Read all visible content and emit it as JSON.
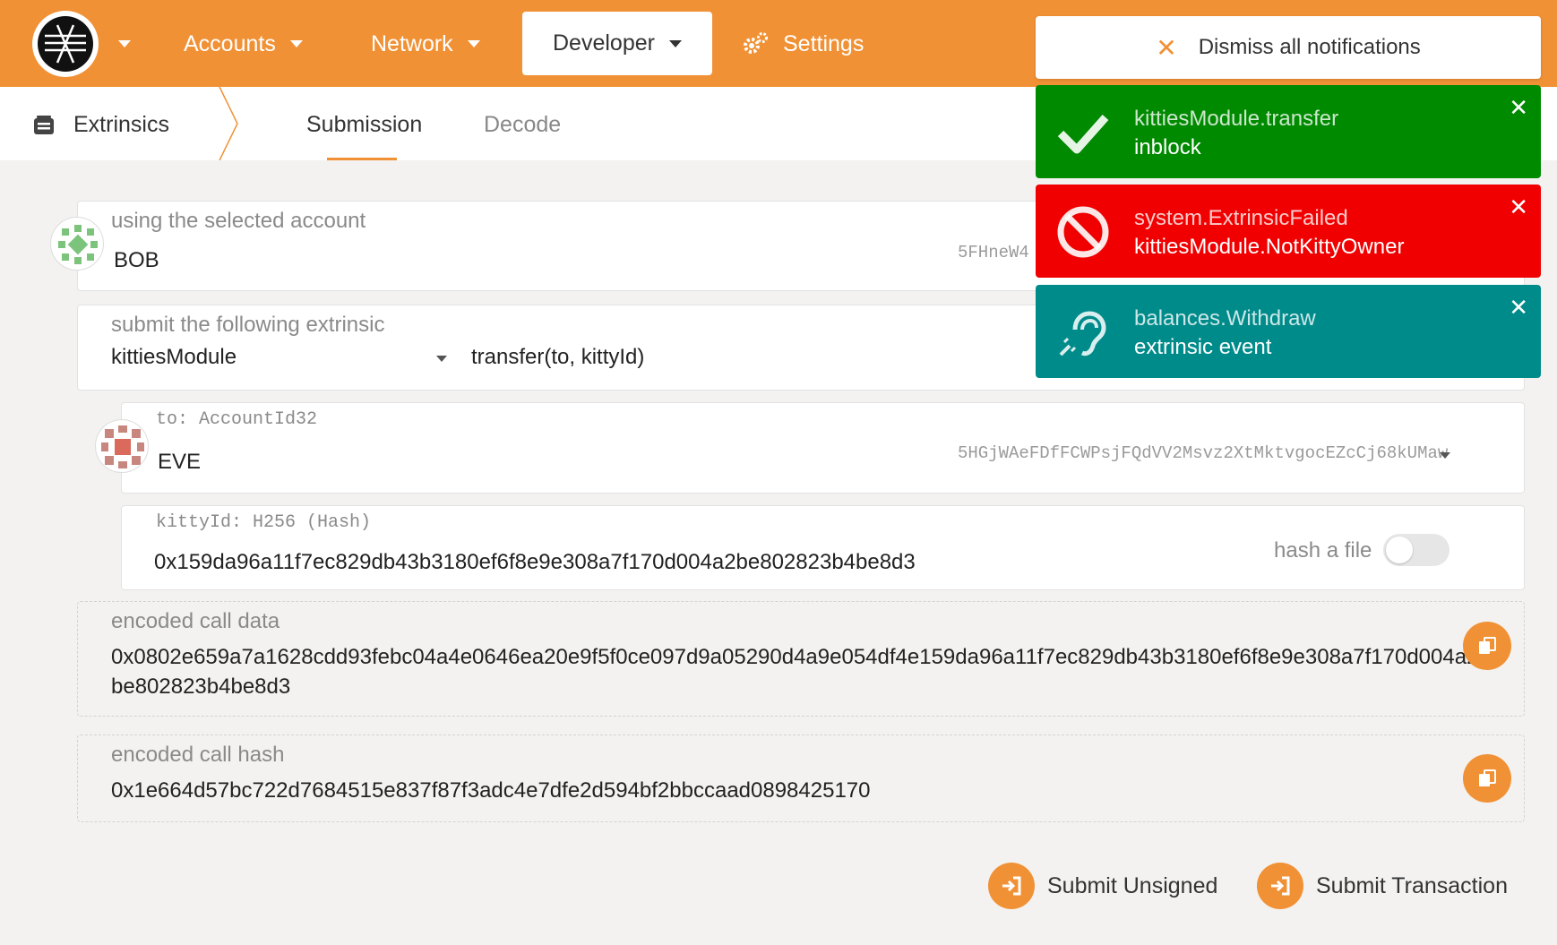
{
  "nav": {
    "items": [
      {
        "label": "Accounts"
      },
      {
        "label": "Network"
      },
      {
        "label": "Developer"
      },
      {
        "label": "Settings"
      }
    ]
  },
  "subnav": {
    "title": "Extrinsics",
    "tabs": [
      {
        "label": "Submission"
      },
      {
        "label": "Decode"
      }
    ]
  },
  "account": {
    "label": "using the selected account",
    "name": "BOB",
    "address": "5FHneW4"
  },
  "extrinsic": {
    "label": "submit the following extrinsic",
    "module": "kittiesModule",
    "method": "transfer(to, kittyId)"
  },
  "param_to": {
    "label": "to: AccountId32",
    "name": "EVE",
    "address": "5HGjWAeFDfFCWPsjFQdVV2Msvz2XtMktvgocEZcCj68kUMaw"
  },
  "param_kitty": {
    "label": "kittyId: H256 (Hash)",
    "value": "0x159da96a11f7ec829db43b3180ef6f8e9e308a7f170d004a2be802823b4be8d3",
    "hash_file_label": "hash a file"
  },
  "encoded_call_data": {
    "label": "encoded call data",
    "line1": "0x0802e659a7a1628cdd93febc04a4e0646ea20e9f5f0ce097d9a05290d4a9e054df4e159da96a11f7ec829db43b3180ef6f8e9e308a7f170d004a2",
    "line2": "be802823b4be8d3"
  },
  "encoded_call_hash": {
    "label": "encoded call hash",
    "value": "0x1e664d57bc722d7684515e837f87f3adc4e7dfe2d594bf2bbccaad0898425170"
  },
  "actions": {
    "submit_unsigned": "Submit Unsigned",
    "submit_transaction": "Submit Transaction"
  },
  "notifications": {
    "dismiss_label": "Dismiss all notifications",
    "items": [
      {
        "title": "kittiesModule.transfer",
        "subtitle": "inblock",
        "color": "#008a00"
      },
      {
        "title": "system.ExtrinsicFailed",
        "subtitle": "kittiesModule.NotKittyOwner",
        "color": "#f00000"
      },
      {
        "title": "balances.Withdraw",
        "subtitle": "extrinsic event",
        "color": "#008b8b"
      }
    ]
  },
  "colors": {
    "brand": "#f19135"
  }
}
